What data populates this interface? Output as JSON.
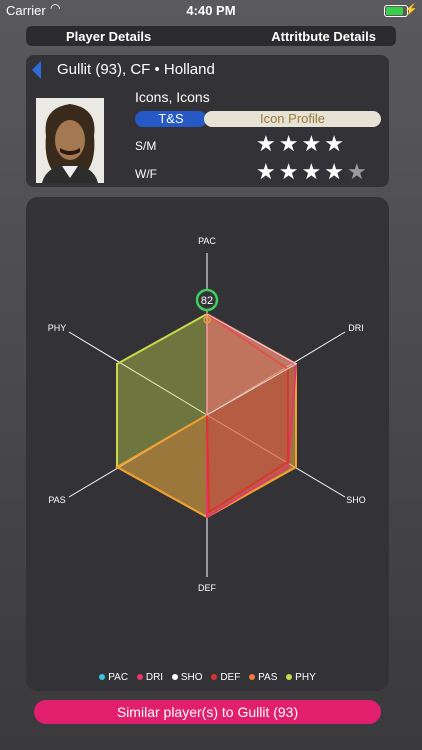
{
  "status": {
    "carrier": "Carrier",
    "time": "4:40 PM",
    "battery_level": 0.85
  },
  "tabs": {
    "player_details": "Player Details",
    "attribute_details": "Attritbute Details"
  },
  "player": {
    "title": "Gullit (93), CF • Holland",
    "club": "Icons, Icons",
    "ts_label": "T&S",
    "profile_label": "Icon Profile",
    "sm_label": "S/M",
    "wf_label": "W/F",
    "skill_moves": 4,
    "weak_foot": 4
  },
  "radar": {
    "axes": [
      "PAC",
      "DRI",
      "SHO",
      "DEF",
      "PAS",
      "PHY"
    ],
    "highlight_value": "82"
  },
  "legend": [
    {
      "label": "PAC",
      "color": "#3bc6e8"
    },
    {
      "label": "DRI",
      "color": "#e8356b"
    },
    {
      "label": "SHO",
      "color": "#ffffff"
    },
    {
      "label": "DEF",
      "color": "#d9362c"
    },
    {
      "label": "PAS",
      "color": "#f07a3a"
    },
    {
      "label": "PHY",
      "color": "#c9d94a"
    }
  ],
  "similar_button": "Similar player(s) to Gullit (93)"
}
